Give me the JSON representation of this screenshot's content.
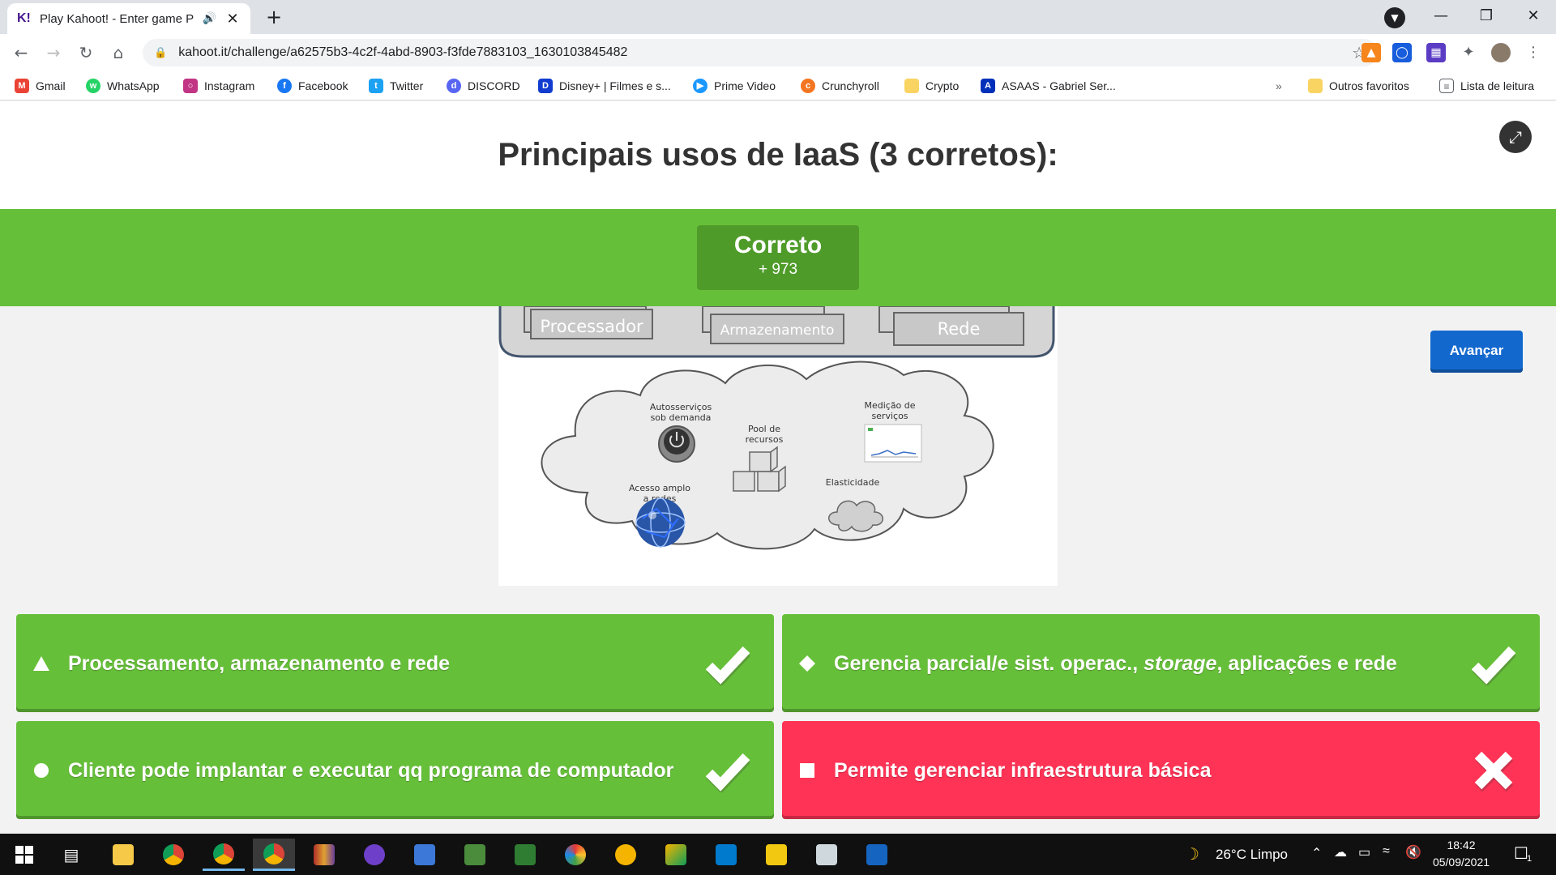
{
  "browser": {
    "tab_title": "Play Kahoot! - Enter game PIN",
    "tab_favicon": "K!",
    "url": "kahoot.it/challenge/a62575b3-4c2f-4abd-8903-f3fde7883103_1630103845482",
    "bookmarks": [
      {
        "label": "Gmail",
        "icon": "gmail-icon",
        "color": "#ea4335"
      },
      {
        "label": "WhatsApp",
        "icon": "whatsapp-icon",
        "color": "#25d366"
      },
      {
        "label": "Instagram",
        "icon": "instagram-icon",
        "color": "#c13584"
      },
      {
        "label": "Facebook",
        "icon": "facebook-icon",
        "color": "#1877f2"
      },
      {
        "label": "Twitter",
        "icon": "twitter-icon",
        "color": "#1da1f2"
      },
      {
        "label": "DISCORD",
        "icon": "discord-icon",
        "color": "#5865f2"
      },
      {
        "label": "Disney+ | Filmes e s...",
        "icon": "disney-icon",
        "color": "#113ccf"
      },
      {
        "label": "Prime Video",
        "icon": "prime-video-icon",
        "color": "#1a98ff"
      },
      {
        "label": "Crunchyroll",
        "icon": "crunchyroll-icon",
        "color": "#f47521"
      },
      {
        "label": "Crypto",
        "icon": "folder-icon",
        "color": "#f9d462"
      },
      {
        "label": "ASAAS - Gabriel Ser...",
        "icon": "asaas-icon",
        "color": "#0030b9"
      }
    ],
    "bookmarks_overflow": "»",
    "other_bookmarks": "Outros favoritos",
    "reading_list": "Lista de leitura"
  },
  "game": {
    "question": "Principais usos de IaaS (3 corretos):",
    "result_title": "Correto",
    "result_points": "+ 973",
    "next_label": "Avançar",
    "diagram": {
      "resources": [
        "Processador",
        "Armazenamento",
        "Rede"
      ],
      "characteristics": {
        "self_service": [
          "Autosserviços",
          "sob demanda"
        ],
        "pool": [
          "Pool de",
          "recursos"
        ],
        "metering": [
          "Medição de",
          "serviços"
        ],
        "network": [
          "Acesso amplo",
          "a redes"
        ],
        "elasticity": "Elasticidade"
      }
    },
    "answers": [
      {
        "shape": "triangle-icon",
        "text": "Processamento, armazenamento e rede",
        "correct": true
      },
      {
        "shape": "diamond-icon",
        "text_before": "Gerencia parcial/e sist. operac., ",
        "text_em": "storage",
        "text_after": ", aplicações e rede",
        "correct": true
      },
      {
        "shape": "circle-icon",
        "text": "Cliente pode implantar e executar qq programa de computador",
        "correct": true
      },
      {
        "shape": "square-icon",
        "text": "Permite gerenciar infraestrutura básica",
        "correct": false
      }
    ],
    "colors": {
      "correct": "#66bf39",
      "wrong": "#ff3355",
      "result_box": "#4f9b2a",
      "next_button": "#1368ce"
    }
  },
  "taskbar": {
    "weather": "26°C  Limpo",
    "time": "18:42",
    "date": "05/09/2021",
    "notifications": "1"
  }
}
